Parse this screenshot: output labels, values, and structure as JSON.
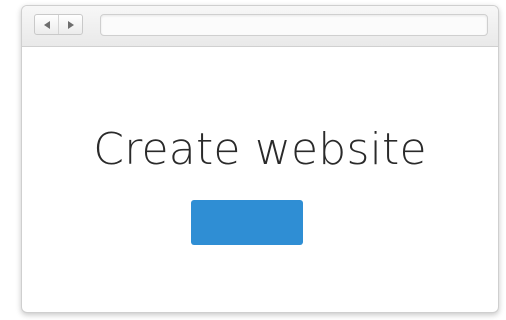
{
  "browser": {
    "address_value": "",
    "nav": {
      "back_icon": "triangle-left",
      "forward_icon": "triangle-right"
    }
  },
  "main": {
    "headline": "Create website",
    "cta_label": "",
    "cta_color": "#2f8ed4"
  }
}
